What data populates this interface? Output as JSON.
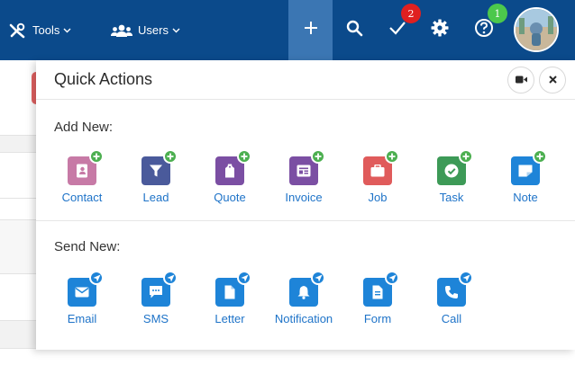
{
  "topbar": {
    "tools_label": "Tools",
    "users_label": "Users",
    "tasks_badge": "2",
    "help_badge": "1",
    "colors": {
      "bar": "#0b4a8b",
      "active": "#3b76b3",
      "badge_red": "#e02020",
      "badge_green": "#4cc84c"
    }
  },
  "panel": {
    "title": "Quick Actions",
    "add_section_label": "Add New:",
    "send_section_label": "Send New:",
    "add_items": [
      {
        "label": "Contact",
        "icon": "contact-card-icon",
        "color": "#c77aa6"
      },
      {
        "label": "Lead",
        "icon": "funnel-icon",
        "color": "#4a5a9b"
      },
      {
        "label": "Quote",
        "icon": "tag-icon",
        "color": "#7b4fa3"
      },
      {
        "label": "Invoice",
        "icon": "invoice-icon",
        "color": "#7b4fa3"
      },
      {
        "label": "Job",
        "icon": "briefcase-icon",
        "color": "#e05b5b"
      },
      {
        "label": "Task",
        "icon": "check-circle-icon",
        "color": "#3d9a57"
      },
      {
        "label": "Note",
        "icon": "note-icon",
        "color": "#1e84d8"
      }
    ],
    "send_items": [
      {
        "label": "Email",
        "icon": "envelope-icon",
        "color": "#1e84d8"
      },
      {
        "label": "SMS",
        "icon": "chat-icon",
        "color": "#1e84d8"
      },
      {
        "label": "Letter",
        "icon": "letter-icon",
        "color": "#1e84d8"
      },
      {
        "label": "Notification",
        "icon": "bell-icon",
        "color": "#1e84d8"
      },
      {
        "label": "Form",
        "icon": "form-icon",
        "color": "#1e84d8"
      },
      {
        "label": "Call",
        "icon": "phone-icon",
        "color": "#1e84d8"
      }
    ],
    "add_badge_color": "#4caf50",
    "send_badge_color": "#1e84d8"
  }
}
